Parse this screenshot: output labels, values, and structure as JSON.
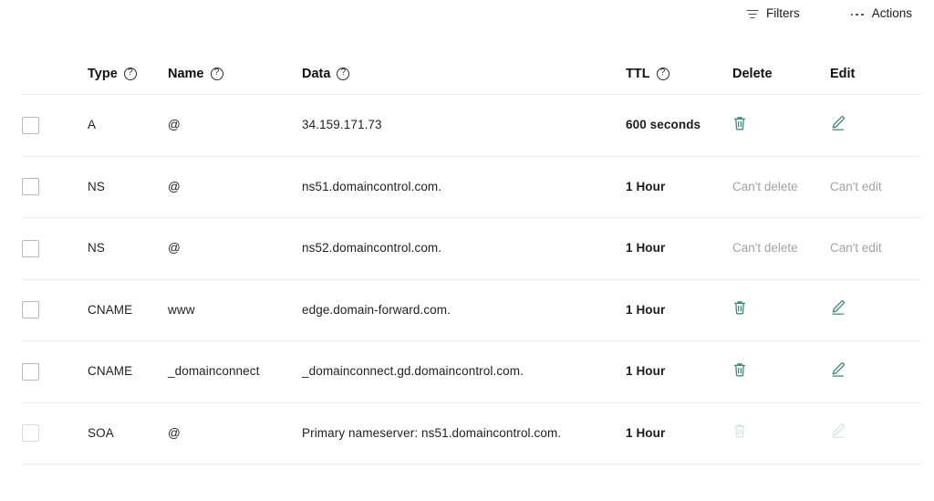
{
  "toolbar": {
    "filters_label": "Filters",
    "filters_icon": "filter-icon",
    "actions_label": "Actions",
    "actions_icon": "ellipsis-icon"
  },
  "table": {
    "help_glyph": "?",
    "columns": [
      {
        "key": "type",
        "label": "Type",
        "help": true
      },
      {
        "key": "name",
        "label": "Name",
        "help": true
      },
      {
        "key": "data",
        "label": "Data",
        "help": true
      },
      {
        "key": "ttl",
        "label": "TTL",
        "help": true
      },
      {
        "key": "delete",
        "label": "Delete",
        "help": false
      },
      {
        "key": "edit",
        "label": "Edit",
        "help": false
      }
    ],
    "rows": [
      {
        "type": "A",
        "name": "@",
        "data": "34.159.171.73",
        "ttl": "600 seconds",
        "delete_state": "enabled",
        "edit_state": "enabled",
        "delete_text": "",
        "edit_text": ""
      },
      {
        "type": "NS",
        "name": "@",
        "data": "ns51.domaincontrol.com.",
        "ttl": "1 Hour",
        "delete_state": "text",
        "edit_state": "text",
        "delete_text": "Can't delete",
        "edit_text": "Can't edit"
      },
      {
        "type": "NS",
        "name": "@",
        "data": "ns52.domaincontrol.com.",
        "ttl": "1 Hour",
        "delete_state": "text",
        "edit_state": "text",
        "delete_text": "Can't delete",
        "edit_text": "Can't edit"
      },
      {
        "type": "CNAME",
        "name": "www",
        "data": "edge.domain-forward.com.",
        "ttl": "1 Hour",
        "delete_state": "enabled",
        "edit_state": "enabled",
        "delete_text": "",
        "edit_text": ""
      },
      {
        "type": "CNAME",
        "name": "_domainconnect",
        "data": "_domainconnect.gd.domaincontrol.com.",
        "ttl": "1 Hour",
        "delete_state": "enabled",
        "edit_state": "enabled",
        "delete_text": "",
        "edit_text": ""
      },
      {
        "type": "SOA",
        "name": "@",
        "data": "Primary nameserver: ns51.domaincontrol.com.",
        "ttl": "1 Hour",
        "delete_state": "disabled",
        "edit_state": "disabled",
        "delete_text": "",
        "edit_text": ""
      }
    ]
  },
  "colors": {
    "accent": "#3d8a7d",
    "text": "#1f1f1f",
    "muted": "#a2a2a2",
    "divider": "#eeeeee",
    "checkbox_border": "#b9b9b9"
  }
}
